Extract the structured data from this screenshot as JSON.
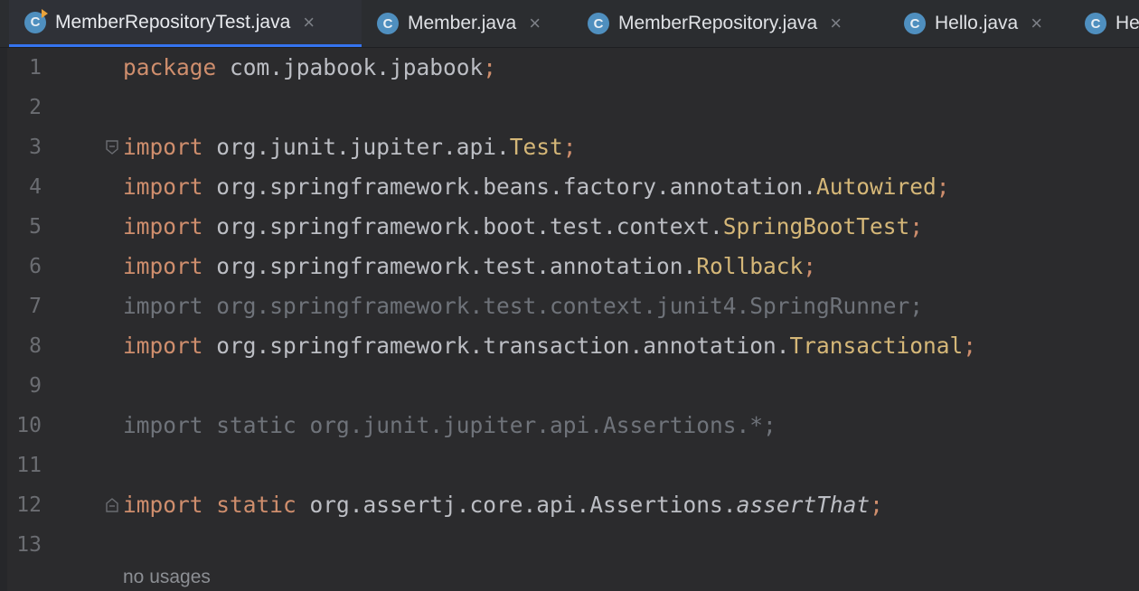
{
  "tabs": [
    {
      "label": "MemberRepositoryTest.java",
      "icon": "class-icon",
      "icon_letter": "C",
      "active": true
    },
    {
      "label": "Member.java",
      "icon": "class-icon",
      "icon_letter": "C"
    },
    {
      "label": "MemberRepository.java",
      "icon": "class-icon",
      "icon_letter": "C"
    },
    {
      "label": "Hello.java",
      "icon": "class-icon",
      "icon_letter": "C"
    },
    {
      "label": "He",
      "icon": "class-icon",
      "icon_letter": "C"
    }
  ],
  "close_glyph": "×",
  "editor": {
    "line_numbers": [
      "1",
      "2",
      "3",
      "4",
      "5",
      "6",
      "7",
      "8",
      "9",
      "10",
      "11",
      "12",
      "13"
    ],
    "lines": {
      "l1": {
        "kw": "package",
        "rest": " com.jpabook.jpabook",
        "semi": ";"
      },
      "l3": {
        "kw": "import",
        "pkg": " org.junit.jupiter.api.",
        "cls": "Test",
        "semi": ";"
      },
      "l4": {
        "kw": "import",
        "pkg": " org.springframework.beans.factory.annotation.",
        "cls": "Autowired",
        "semi": ";"
      },
      "l5": {
        "kw": "import",
        "pkg": " org.springframework.boot.test.context.",
        "cls": "SpringBootTest",
        "semi": ";"
      },
      "l6": {
        "kw": "import",
        "pkg": " org.springframework.test.annotation.",
        "cls": "Rollback",
        "semi": ";"
      },
      "l7": {
        "text": "import org.springframework.test.context.junit4.SpringRunner;"
      },
      "l8": {
        "kw": "import",
        "pkg": " org.springframework.transaction.annotation.",
        "cls": "Transactional",
        "semi": ";"
      },
      "l10": {
        "text": "import static org.junit.jupiter.api.Assertions.*;"
      },
      "l12": {
        "kw1": "import",
        "kw2": "static",
        "pkg": " org.assertj.core.api.Assertions.",
        "method": "assertThat",
        "semi": ";"
      }
    },
    "inlay_hint": "no usages"
  },
  "colors": {
    "keyword": "#cf8e6d",
    "class": "#d5b778",
    "text": "#bcbec4",
    "unused": "#6f737a",
    "accent": "#3574f0"
  }
}
